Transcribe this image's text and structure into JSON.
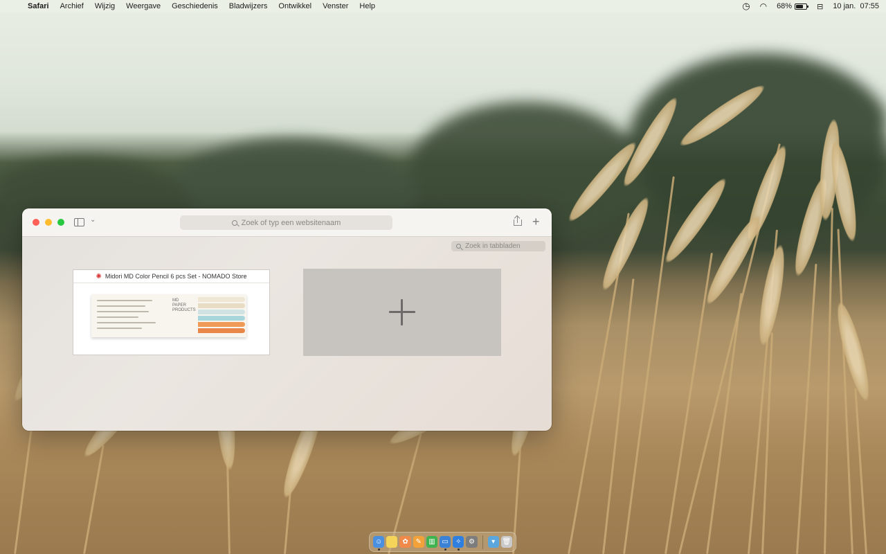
{
  "menubar": {
    "app_name": "Safari",
    "items": [
      "Archief",
      "Wijzig",
      "Weergave",
      "Geschiedenis",
      "Bladwijzers",
      "Ontwikkel",
      "Venster",
      "Help"
    ],
    "battery_percent": "68%",
    "battery_level": 0.68,
    "date": "10 jan.",
    "time": "07:55"
  },
  "safari": {
    "address_placeholder": "Zoek of typ een websitenaam",
    "tab_search_placeholder": "Zoek in tabbladen",
    "tabs": [
      {
        "title": "Midori MD Color Pencil 6 pcs Set - NOMADO Store"
      }
    ],
    "preview": {
      "logo_lines": [
        "MD",
        "PAPER",
        "PRODUCTS"
      ],
      "pencil_colors": [
        "#efe6d3",
        "#e8ddc4",
        "#cfe3e2",
        "#a9d6db",
        "#ef9a56",
        "#e9874a"
      ]
    }
  },
  "dock": {
    "apps": [
      {
        "name": "finder-icon",
        "color": "#4a8fe0",
        "glyph": "☺",
        "running": true
      },
      {
        "name": "notes-icon",
        "color": "#f4d55a",
        "glyph": "",
        "running": false
      },
      {
        "name": "photos-icon",
        "color": "#f08a4b",
        "glyph": "✿",
        "running": false
      },
      {
        "name": "pages-icon",
        "color": "#f3a23a",
        "glyph": "✎",
        "running": false
      },
      {
        "name": "numbers-icon",
        "color": "#3fb34f",
        "glyph": "▥",
        "running": false
      },
      {
        "name": "keynote-icon",
        "color": "#3b82d6",
        "glyph": "▭",
        "running": true
      },
      {
        "name": "safari-icon",
        "color": "#2e7fe0",
        "glyph": "✧",
        "running": true
      },
      {
        "name": "system-settings-icon",
        "color": "#7d7d7d",
        "glyph": "⚙",
        "running": false
      }
    ],
    "extras": [
      {
        "name": "downloads-folder-icon",
        "color": "#5aa6dd",
        "glyph": "▾"
      },
      {
        "name": "trash-icon",
        "color": "#c9c9c9",
        "glyph": "🗑"
      }
    ]
  }
}
